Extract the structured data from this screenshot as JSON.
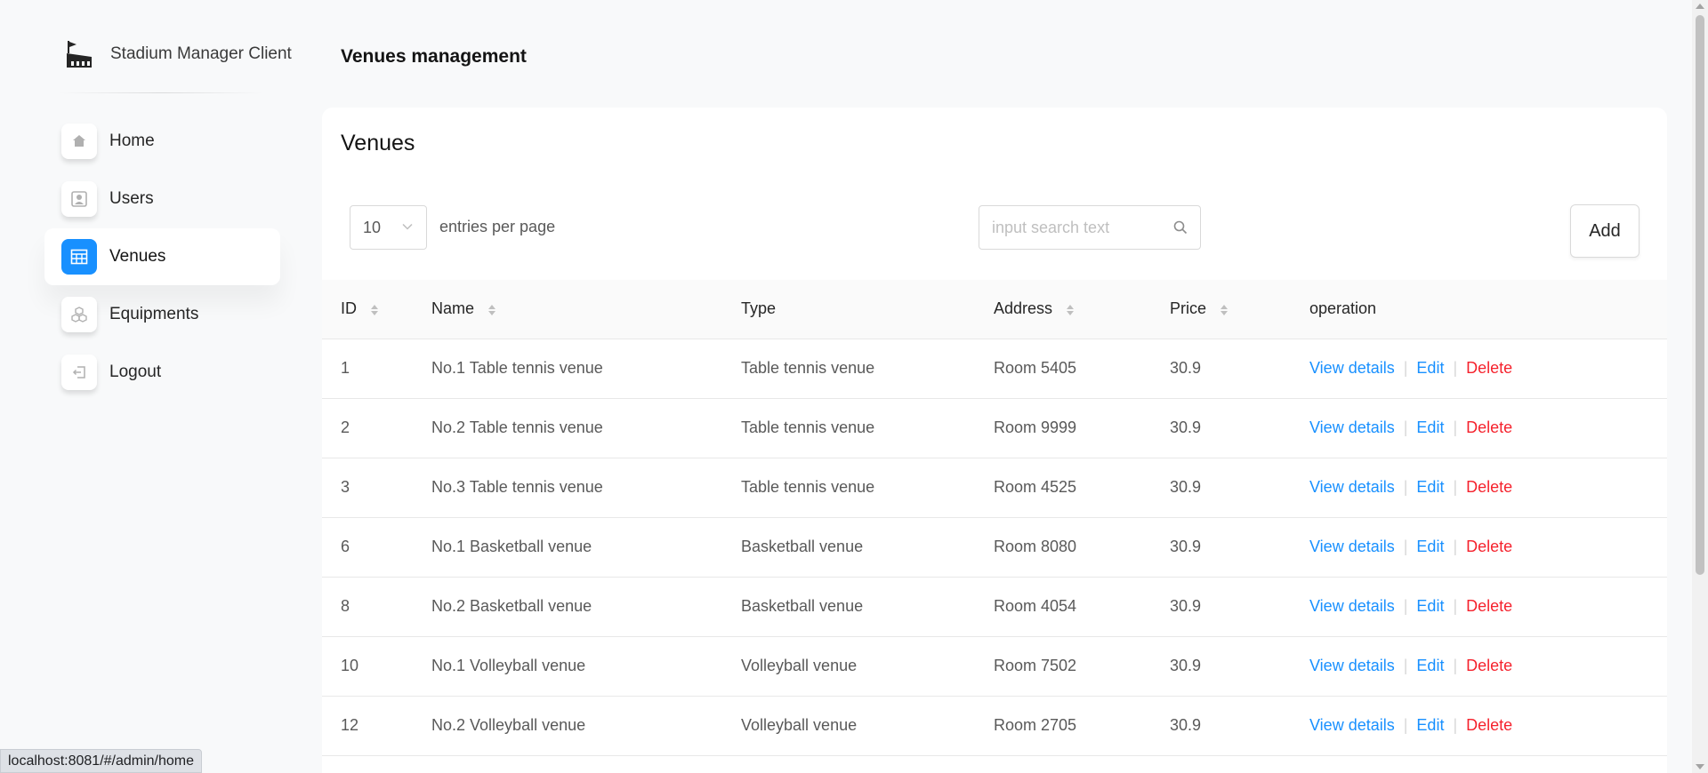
{
  "brand": {
    "name": "Stadium Manager Client"
  },
  "sidebar": {
    "items": [
      {
        "label": "Home",
        "icon": "home-icon",
        "active": false
      },
      {
        "label": "Users",
        "icon": "user-icon",
        "active": false
      },
      {
        "label": "Venues",
        "icon": "table-icon",
        "active": true
      },
      {
        "label": "Equipments",
        "icon": "equipment-icon",
        "active": false
      },
      {
        "label": "Logout",
        "icon": "logout-icon",
        "active": false
      }
    ]
  },
  "header": {
    "title": "Venues management"
  },
  "card": {
    "title": "Venues",
    "per_page_value": "10",
    "per_page_label": "entries per page",
    "search_placeholder": "input search text",
    "add_label": "Add"
  },
  "table": {
    "columns": [
      "ID",
      "Name",
      "Type",
      "Address",
      "Price",
      "operation"
    ],
    "rows": [
      {
        "id": "1",
        "name": "No.1 Table tennis venue",
        "type": "Table tennis venue",
        "address": "Room 5405",
        "price": "30.9"
      },
      {
        "id": "2",
        "name": "No.2 Table tennis venue",
        "type": "Table tennis venue",
        "address": "Room 9999",
        "price": "30.9"
      },
      {
        "id": "3",
        "name": "No.3 Table tennis venue",
        "type": "Table tennis venue",
        "address": "Room 4525",
        "price": "30.9"
      },
      {
        "id": "6",
        "name": "No.1 Basketball venue",
        "type": "Basketball venue",
        "address": "Room 8080",
        "price": "30.9"
      },
      {
        "id": "8",
        "name": "No.2 Basketball venue",
        "type": "Basketball venue",
        "address": "Room 4054",
        "price": "30.9"
      },
      {
        "id": "10",
        "name": "No.1 Volleyball venue",
        "type": "Volleyball venue",
        "address": "Room 7502",
        "price": "30.9"
      },
      {
        "id": "12",
        "name": "No.2 Volleyball venue",
        "type": "Volleyball venue",
        "address": "Room 2705",
        "price": "30.9"
      }
    ],
    "actions": {
      "view": "View details",
      "edit": "Edit",
      "delete": "Delete",
      "separator": "|"
    }
  },
  "status_bar": {
    "url": "localhost:8081/#/admin/home"
  },
  "colors": {
    "accent": "#1890ff",
    "danger": "#f5222d"
  }
}
